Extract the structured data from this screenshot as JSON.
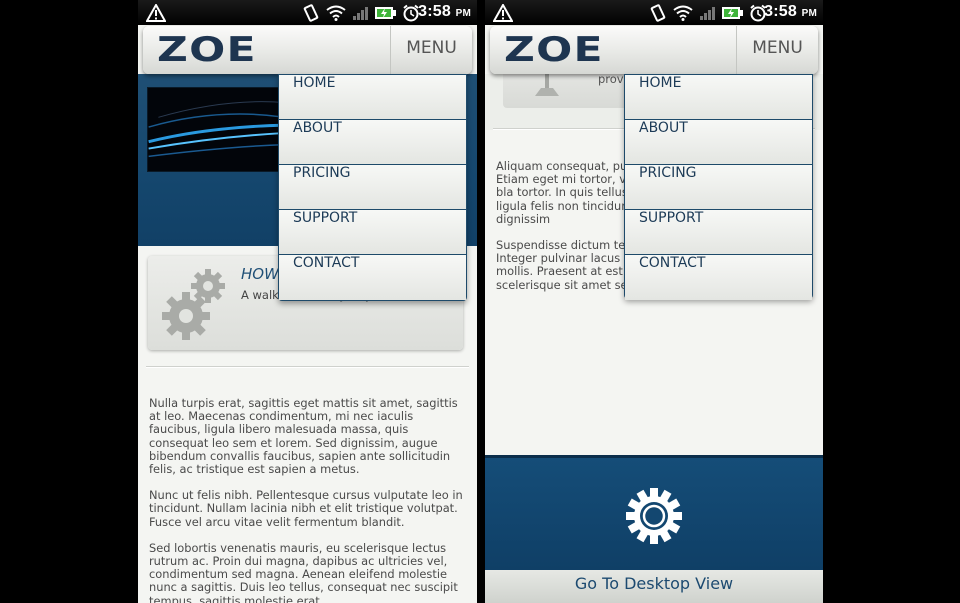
{
  "status_bar": {
    "time": "3:58",
    "ampm": "PM"
  },
  "header": {
    "logo": "ZOE",
    "menu_label": "MENU"
  },
  "nav": {
    "items": [
      "HOME",
      "ABOUT",
      "PRICING",
      "SUPPORT",
      "CONTACT"
    ]
  },
  "left_screen": {
    "feature": {
      "title": "HOW",
      "desc": "A walk new reality to your world"
    },
    "paragraphs": [
      "Nulla turpis erat, sagittis eget mattis sit amet, sagittis at leo. Maecenas condimentum, mi nec iaculis faucibus, ligula libero malesuada massa, quis consequat leo sem et lorem. Sed dignissim, augue bibendum convallis faucibus, sapien ante sollicitudin felis, ac tristique est sapien a metus.",
      "Nunc ut felis nibh. Pellentesque cursus vulputate leo in tincidunt. Nullam lacinia nibh et elit tristique volutpat. Fusce vel arcu vitae velit fermentum blandit.",
      "Sed lobortis venenatis mauris, eu scelerisque lectus rutrum ac. Proin dui magna, dapibus ac ultricies vel, condimentum sed magna. Aenean eleifend molestie nunc a sagittis. Duis leo tellus, consequat nec suscipit tempus, sagittis molestie erat."
    ]
  },
  "right_screen": {
    "card_text": "prov",
    "paragraphs": [
      "Aliquam consequat, pur lorem neque rutrum er Etiam eget mi tortor, ve velit. Cras odio nisl, bla tortor. In quis tellus lor rhoncus eu mollis ligula felis non tincidunt. Don Donec viverra dignissim",
      "Suspendisse dictum tell facilisis nisi tempor. Integer pulvinar lacus vitae sem scelerisque mollis. Praesent at est eu magna mollis scelerisque sit amet sed lacus."
    ],
    "desktop_link": "Go To Desktop View"
  }
}
